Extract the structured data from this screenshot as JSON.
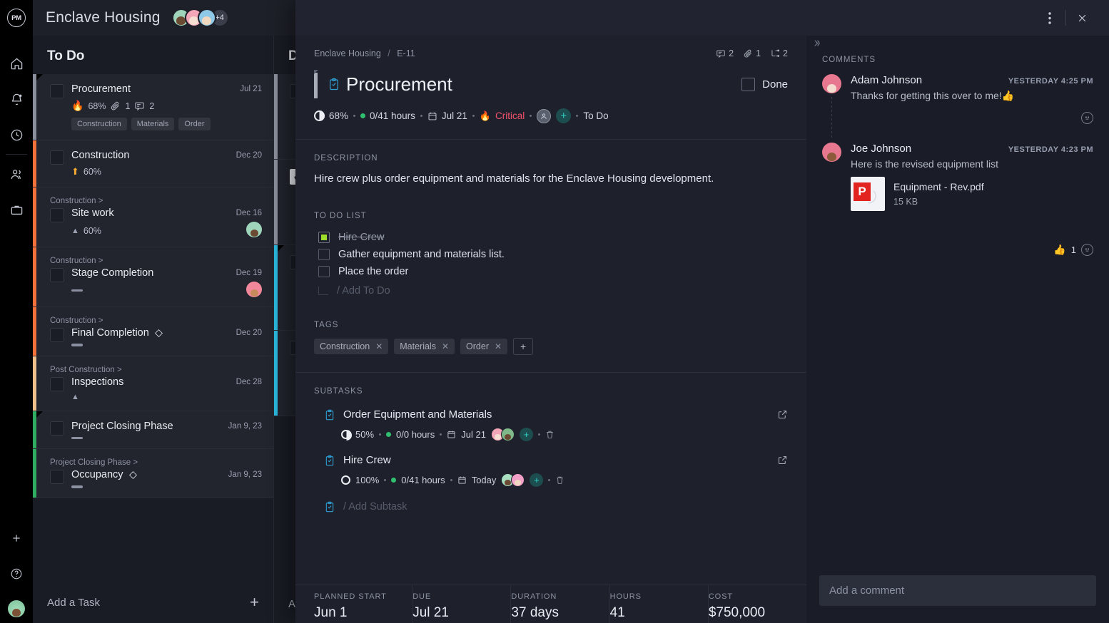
{
  "rail": {
    "logo": "PM",
    "items": [
      {
        "name": "home-icon",
        "label": "Home"
      },
      {
        "name": "notifications-icon",
        "label": "Notifications"
      },
      {
        "name": "recent-icon",
        "label": "Recent"
      },
      {
        "name": "people-icon",
        "label": "People"
      },
      {
        "name": "portfolio-icon",
        "label": "Portfolio"
      }
    ],
    "bottom": [
      {
        "name": "add-icon",
        "label": "Add"
      },
      {
        "name": "help-icon",
        "label": "Help"
      }
    ]
  },
  "board": {
    "project_title": "Enclave Housing",
    "avatar_overflow": "+4",
    "columns": [
      {
        "title": "To Do",
        "add_label": "Add a Task",
        "tasks": [
          {
            "name": "Procurement",
            "date": "Jul 21",
            "parent": "",
            "progress": "68%",
            "progress_icon": "fire-icon",
            "attachments": "1",
            "comments": "2",
            "tags": [
              "Construction",
              "Materials",
              "Order"
            ],
            "stripe": "#8b8f9b"
          },
          {
            "name": "Construction",
            "date": "Dec 20",
            "parent": "",
            "progress": "60%",
            "progress_icon": "up-arrow-icon",
            "tags": [],
            "stripe": "#f2703a"
          },
          {
            "name": "Site work",
            "date": "Dec 16",
            "parent": "Construction >",
            "progress": "60%",
            "progress_icon": "triangle-up-icon",
            "tags": [],
            "stripe": "#f2703a"
          },
          {
            "name": "Stage Completion",
            "date": "Dec 19",
            "parent": "Construction >",
            "progress": "",
            "progress_icon": "dash-icon",
            "tags": [],
            "stripe": "#f2703a"
          },
          {
            "name": "Final Completion",
            "date": "Dec 20",
            "parent": "Construction >",
            "progress": "",
            "progress_icon": "dash-icon",
            "milestone": true,
            "tags": [],
            "stripe": "#f2703a"
          },
          {
            "name": "Inspections",
            "date": "Dec 28",
            "parent": "Post Construction >",
            "progress": "",
            "progress_icon": "triangle-up-icon",
            "tags": [],
            "stripe": "#f0c08a"
          },
          {
            "name": "Project Closing Phase",
            "date": "Jan 9, 23",
            "parent": "",
            "progress": "",
            "progress_icon": "dash-icon",
            "tags": [],
            "stripe": "#2fae62"
          },
          {
            "name": "Occupancy",
            "date": "Jan 9, 23",
            "parent": "Project Closing Phase >",
            "progress": "",
            "progress_icon": "dash-icon",
            "milestone": true,
            "tags": [],
            "stripe": "#2fae62"
          }
        ]
      },
      {
        "title": "D",
        "add_label": "Ad",
        "tasks": [
          {
            "stripe": "#8b8f9b"
          },
          {
            "stripe": "#8b8f9b",
            "checked": true
          },
          {
            "stripe": "#2bb9de"
          },
          {
            "stripe": "#2bb9de"
          }
        ]
      }
    ]
  },
  "modal": {
    "menu_icon": "more-vertical-icon",
    "close_icon": "close-icon",
    "breadcrumb": {
      "project": "Enclave Housing",
      "separator": "/",
      "id": "E-11"
    },
    "counters": [
      {
        "icon": "comment-icon",
        "value": "2"
      },
      {
        "icon": "attachment-icon",
        "value": "1"
      },
      {
        "icon": "subtask-icon",
        "value": "2"
      }
    ],
    "task": {
      "icon": "task-clipboard-icon",
      "title": "Procurement",
      "done_label": "Done",
      "done_checked": false,
      "meta": {
        "progress": "68%",
        "hours": "0/41 hours",
        "date": "Jul 21",
        "priority": "Critical",
        "priority_icon": "fire-icon",
        "status": "To Do"
      }
    },
    "description": {
      "label": "DESCRIPTION",
      "text": "Hire crew plus order equipment and materials for the Enclave Housing development."
    },
    "todo": {
      "label": "TO DO LIST",
      "items": [
        {
          "text": "Hire Crew",
          "done": true
        },
        {
          "text": "Gather equipment and materials list.",
          "done": false
        },
        {
          "text": "Place the order",
          "done": false
        }
      ],
      "add_placeholder": "/ Add To Do"
    },
    "tags": {
      "label": "TAGS",
      "items": [
        "Construction",
        "Materials",
        "Order"
      ],
      "add_label": "+"
    },
    "subtasks": {
      "label": "SUBTASKS",
      "items": [
        {
          "name": "Order Equipment and Materials",
          "progress": "50%",
          "hours": "0/0 hours",
          "date": "Jul 21",
          "avatars": [
            "#f2b8c6",
            "#6f9e72"
          ]
        },
        {
          "name": "Hire Crew",
          "progress": "100%",
          "hours": "0/41 hours",
          "date": "Today",
          "avatars": [
            "#a8dfc0",
            "#f2a0c8"
          ]
        }
      ],
      "add_placeholder": "/ Add Subtask"
    },
    "fields": [
      {
        "label": "PLANNED START",
        "value": "Jun 1"
      },
      {
        "label": "DUE",
        "value": "Jul 21"
      },
      {
        "label": "DURATION",
        "value": "37 days"
      },
      {
        "label": "HOURS",
        "value": "41"
      },
      {
        "label": "COST",
        "value": "$750,000"
      }
    ]
  },
  "comments": {
    "collapse_icon": "chevron-double-right-icon",
    "header": "COMMENTS",
    "items": [
      {
        "author": "Adam Johnson",
        "time": "YESTERDAY 4:25 PM",
        "text": "Thanks for getting this over to me!👍",
        "avatar_color": "#e8788f",
        "skin": "#f3ddd0",
        "reactions": []
      },
      {
        "author": "Joe Johnson",
        "time": "YESTERDAY 4:23 PM",
        "text": "Here is the revised equipment list",
        "avatar_color": "#e8788f",
        "skin": "#8e5a3c",
        "attachment": {
          "name": "Equipment - Rev.pdf",
          "size": "15 KB",
          "badge": "P"
        },
        "reactions": [
          {
            "emoji": "👍",
            "count": "1"
          }
        ]
      }
    ],
    "input_placeholder": "Add a comment"
  },
  "colors": {
    "accent_teal": "#2ed0c5",
    "critical_red": "#f4516b",
    "green": "#2fbf6e",
    "modal_bg": "#1e212c",
    "board_bg": "#1a1c25"
  }
}
